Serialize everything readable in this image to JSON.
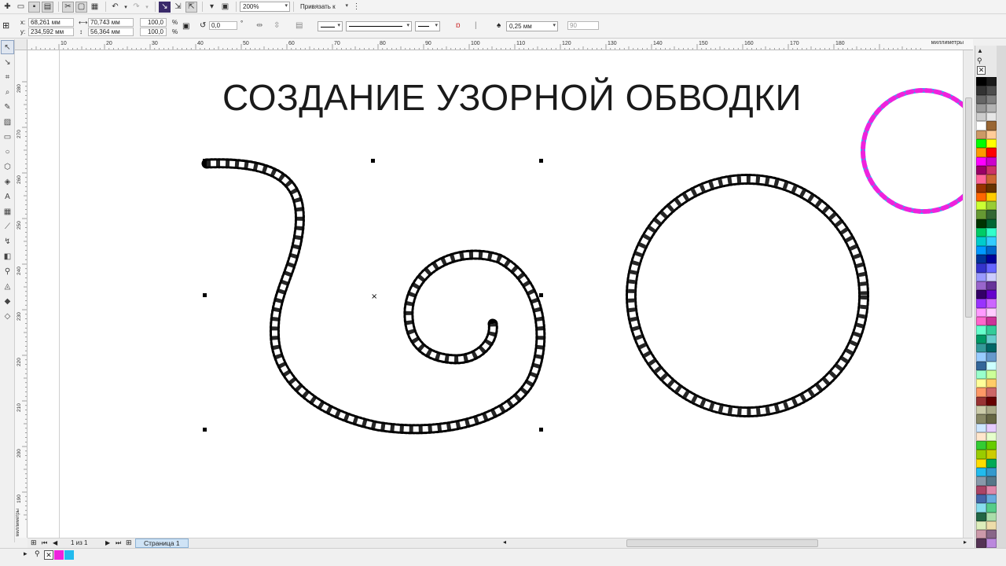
{
  "toolbar": {
    "zoom_value": "200%",
    "snap_label": "Привязать к"
  },
  "propertybar": {
    "x_label": "x:",
    "x_value": "68,261 мм",
    "y_label": "y:",
    "y_value": "234,592 мм",
    "w_value": "70,743 мм",
    "h_value": "56,364 мм",
    "scale_w": "100,0",
    "scale_h": "100,0",
    "pct": "%",
    "angle_value": "0,0",
    "deg": "°",
    "outline_width": "0,25 мм",
    "miter": "90"
  },
  "ruler": {
    "h_ticks": [
      "10",
      "20",
      "30",
      "40",
      "50",
      "60",
      "70",
      "80",
      "90",
      "100",
      "110",
      "120",
      "130",
      "140",
      "150",
      "160",
      "170",
      "180"
    ],
    "h_unit": "миллиметры",
    "v_ticks": [
      "280",
      "270",
      "260",
      "250",
      "240",
      "230",
      "220",
      "210",
      "200",
      "190"
    ],
    "v_unit": "миллиметры"
  },
  "canvas": {
    "title": "СОЗДАНИЕ УЗОРНОЙ ОБВОДКИ"
  },
  "pagebar": {
    "page_counter": "1 из 1",
    "page_tab": "Страница 1"
  },
  "colors": {
    "magenta": "#ee22dd",
    "cyan": "#22bbee",
    "selection_handle": "#000000"
  }
}
